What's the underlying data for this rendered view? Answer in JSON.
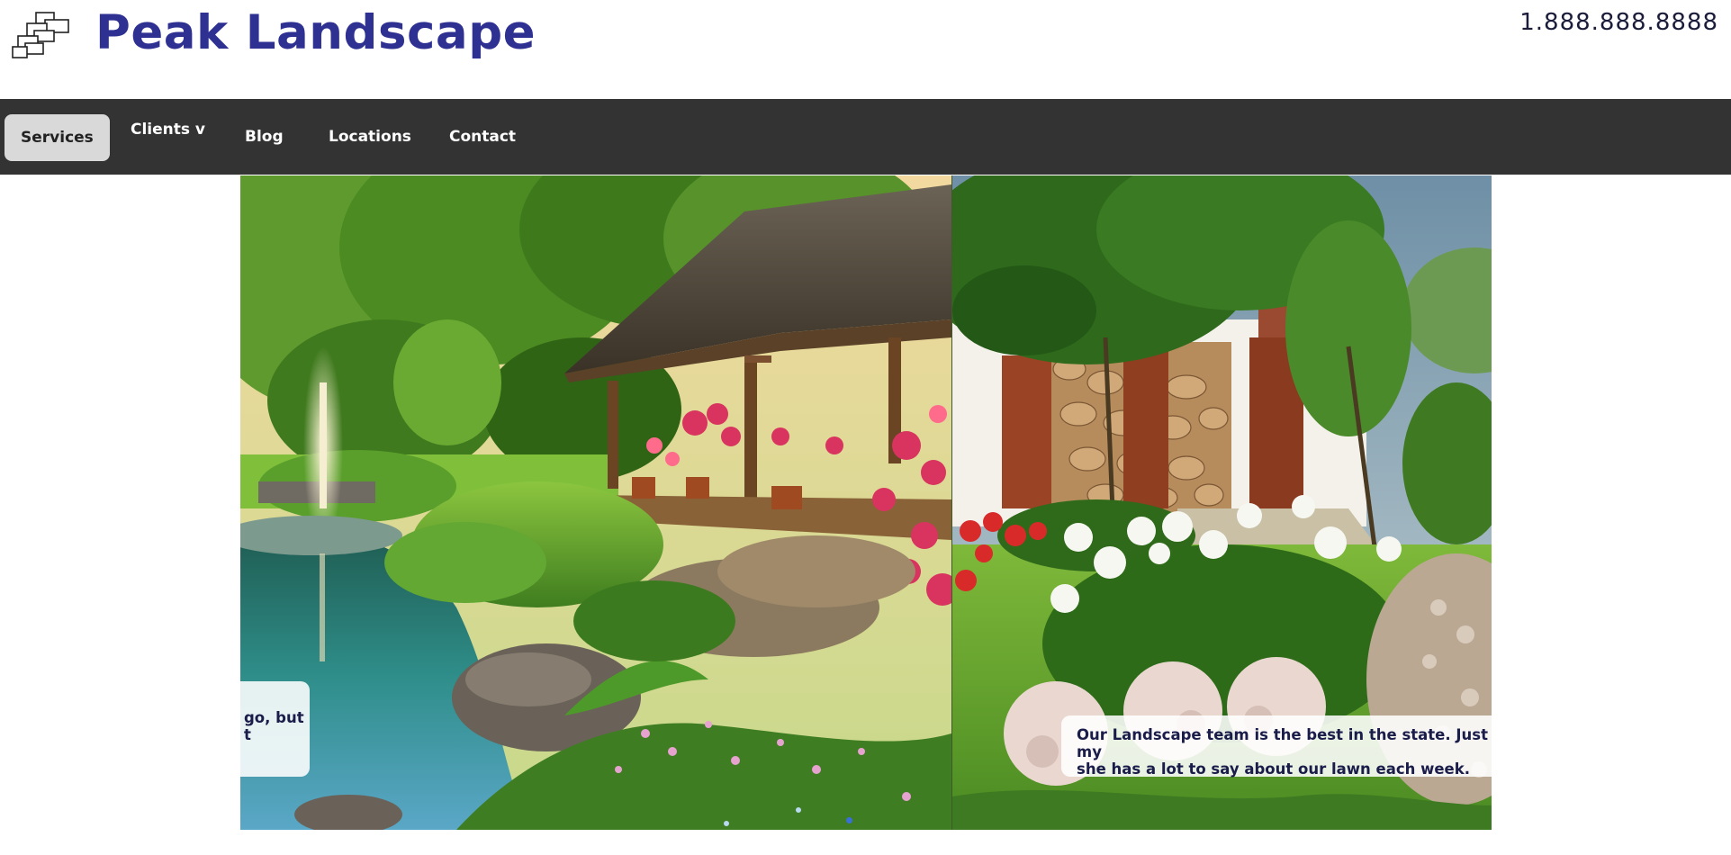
{
  "header": {
    "brand_name": "Peak Landscape",
    "phone": "1.888.888.8888",
    "logo_icon": "stacked-blocks-logo-icon"
  },
  "nav": {
    "items": [
      {
        "label": "Services",
        "active": true
      },
      {
        "label": "Clients v",
        "active": false
      },
      {
        "label": "Blog",
        "active": false
      },
      {
        "label": "Locations",
        "active": false
      },
      {
        "label": "Contact",
        "active": false
      }
    ]
  },
  "carousel": {
    "slides": [
      {
        "caption_line1": "go, but",
        "caption_line2": "t"
      },
      {
        "caption_line1": "Our Landscape team is the best in the state. Just ask my",
        "caption_line2": "she has a lot to say about our lawn each week."
      }
    ]
  },
  "colors": {
    "brand": "#2e3192",
    "nav_background": "#333333",
    "nav_active": "#d9d9d9",
    "indicator": "#3b6fd8"
  }
}
